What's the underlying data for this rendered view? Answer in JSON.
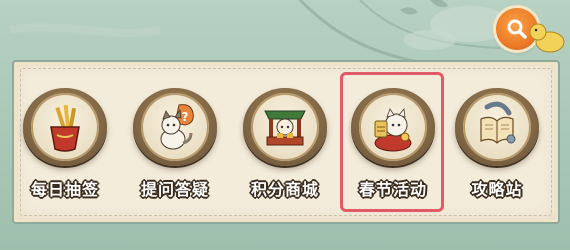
{
  "menu": {
    "items": [
      {
        "label": "每日抽签",
        "icon": "fortune-stick-icon"
      },
      {
        "label": "提问答疑",
        "icon": "cat-question-icon"
      },
      {
        "label": "积分商城",
        "icon": "cat-shop-icon"
      },
      {
        "label": "春节活动",
        "icon": "lucky-cat-festival-icon"
      },
      {
        "label": "攻略站",
        "icon": "guide-book-icon"
      }
    ],
    "highlighted_index": 3
  },
  "colors": {
    "highlight_border": "#e05a68",
    "search_button": "#ee7b26",
    "panel": "#f4ecda"
  }
}
